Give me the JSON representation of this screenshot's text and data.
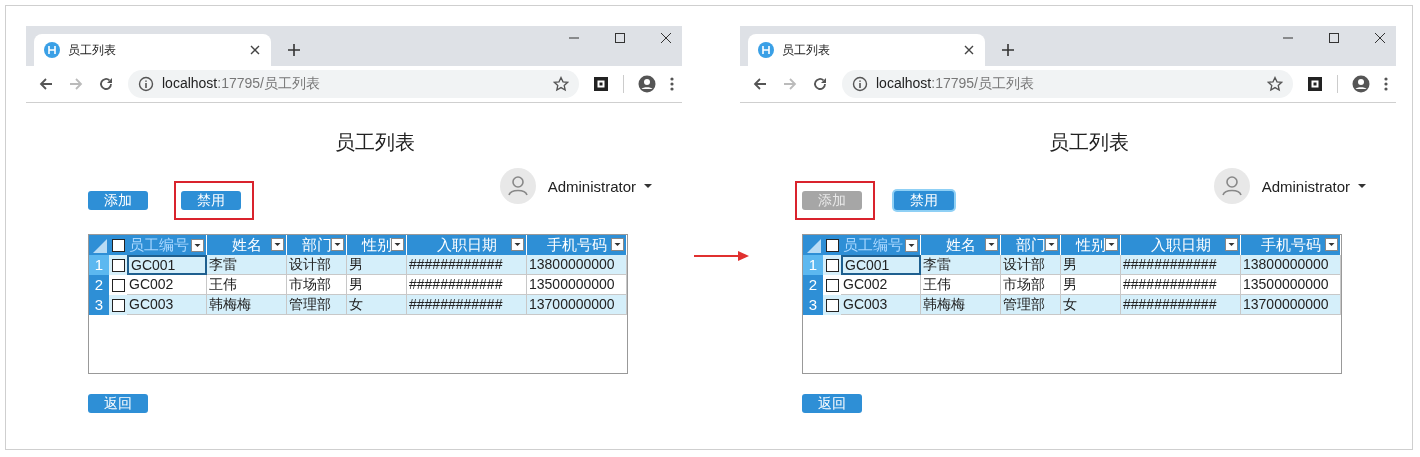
{
  "windows": [
    {
      "tab": {
        "title": "员工列表"
      },
      "address": {
        "host": "localhost",
        "path": ":17795/员工列表"
      },
      "heading": "员工列表",
      "buttons": [
        {
          "label": "添加",
          "disabled": false,
          "focused": false,
          "highlighted": false
        },
        {
          "label": "禁用",
          "disabled": false,
          "focused": false,
          "highlighted": true
        }
      ],
      "user": {
        "name": "Administrator"
      },
      "table": {
        "header_checked": false,
        "columns": [
          {
            "label": "员工编号",
            "selected": true
          },
          {
            "label": "姓名",
            "selected": false
          },
          {
            "label": "部门",
            "selected": false
          },
          {
            "label": "性别",
            "selected": false
          },
          {
            "label": "入职日期",
            "selected": false
          },
          {
            "label": "手机号码",
            "selected": false
          }
        ],
        "rows": [
          {
            "number": "1",
            "selected": true,
            "checked": false,
            "cells": [
              "GC001",
              "李雷",
              "设计部",
              "男",
              "############",
              "13800000000"
            ]
          },
          {
            "number": "2",
            "selected": false,
            "checked": false,
            "cells": [
              "GC002",
              "王伟",
              "市场部",
              "男",
              "############",
              "13500000000"
            ]
          },
          {
            "number": "3",
            "selected": false,
            "checked": false,
            "cells": [
              "GC003",
              "韩梅梅",
              "管理部",
              "女",
              "############",
              "13700000000"
            ]
          }
        ]
      },
      "back_button": "返回"
    },
    {
      "tab": {
        "title": "员工列表"
      },
      "address": {
        "host": "localhost",
        "path": ":17795/员工列表"
      },
      "heading": "员工列表",
      "buttons": [
        {
          "label": "添加",
          "disabled": true,
          "focused": false,
          "highlighted": true
        },
        {
          "label": "禁用",
          "disabled": false,
          "focused": true,
          "highlighted": false
        }
      ],
      "user": {
        "name": "Administrator"
      },
      "table": {
        "header_checked": false,
        "columns": [
          {
            "label": "员工编号",
            "selected": true
          },
          {
            "label": "姓名",
            "selected": false
          },
          {
            "label": "部门",
            "selected": false
          },
          {
            "label": "性别",
            "selected": false
          },
          {
            "label": "入职日期",
            "selected": false
          },
          {
            "label": "手机号码",
            "selected": false
          }
        ],
        "rows": [
          {
            "number": "1",
            "selected": true,
            "checked": false,
            "cells": [
              "GC001",
              "李雷",
              "设计部",
              "男",
              "############",
              "13800000000"
            ]
          },
          {
            "number": "2",
            "selected": false,
            "checked": false,
            "cells": [
              "GC002",
              "王伟",
              "市场部",
              "男",
              "############",
              "13500000000"
            ]
          },
          {
            "number": "3",
            "selected": false,
            "checked": false,
            "cells": [
              "GC003",
              "韩梅梅",
              "管理部",
              "女",
              "############",
              "13700000000"
            ]
          }
        ]
      },
      "back_button": "返回"
    }
  ]
}
